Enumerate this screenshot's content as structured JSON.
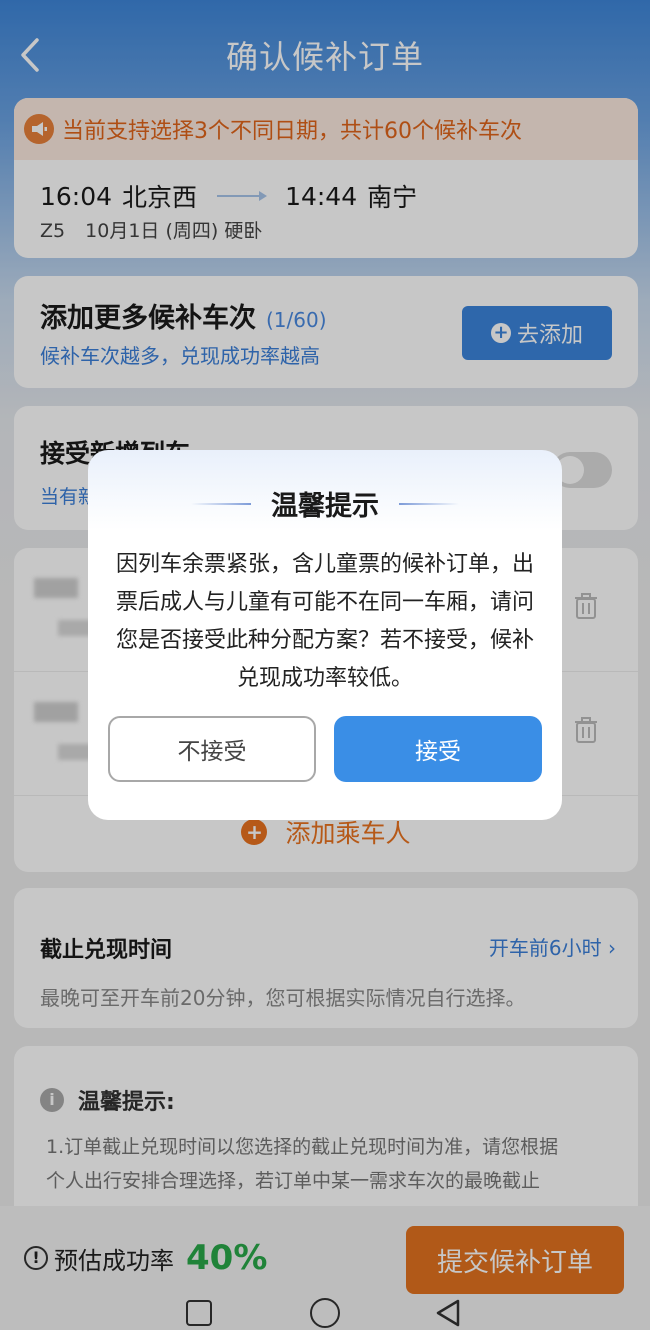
{
  "header": {
    "title": "确认候补订单"
  },
  "notice": {
    "text": "当前支持选择3个不同日期，共计60个候补车次"
  },
  "trip": {
    "depart_time": "16:04",
    "depart_station": "北京西",
    "arrive_time": "14:44",
    "arrive_station": "南宁",
    "train": "Z5",
    "date": "10月1日 (周四)",
    "seat": "硬卧"
  },
  "add_trains": {
    "title": "添加更多候补车次",
    "count": "(1/60)",
    "subtitle": "候补车次越多，兑现成功率越高",
    "button_label": "去添加"
  },
  "accept_new": {
    "title": "接受新增列车",
    "subtitle": "当有新"
  },
  "passengers": {
    "add_label": "添加乘车人"
  },
  "deadline": {
    "title": "截止兑现时间",
    "value": "开车前6小时",
    "subtitle": "最晚可至开车前20分钟，您可根据实际情况自行选择。"
  },
  "tips": {
    "title": "温馨提示:",
    "line1": "1.订单截止兑现时间以您选择的截止兑现时间为准，请您根据",
    "line2": "个人出行安排合理选择，若订单中某一需求车次的最晚截止"
  },
  "bottom": {
    "rate_label": "预估成功率",
    "rate_value": "40%",
    "submit_label": "提交候补订单"
  },
  "dialog": {
    "title": "温馨提示",
    "message": "因列车余票紧张，含儿童票的候补订单，出票后成人与儿童有可能不在同一车厢，请问您是否接受此种分配方案？若不接受，候补兑现成功率较低。",
    "reject_label": "不接受",
    "accept_label": "接受"
  }
}
